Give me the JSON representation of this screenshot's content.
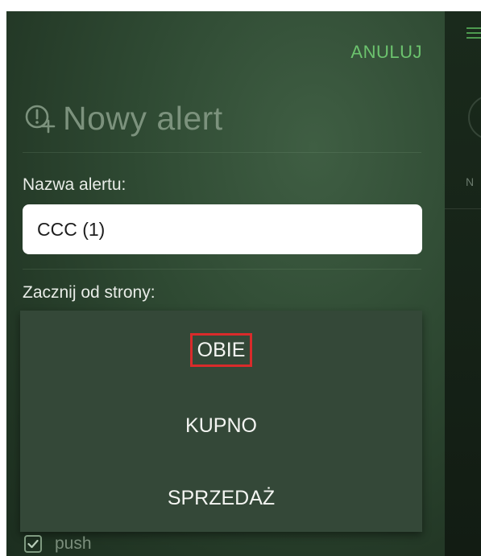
{
  "header": {
    "cancel_label": "ANULUJ",
    "title": "Nowy alert",
    "title_icon": "alert-add-icon"
  },
  "form": {
    "name_label": "Nazwa alertu:",
    "name_value": "CCC (1)",
    "side_label": "Zacznij od strony:"
  },
  "side_dropdown": {
    "options": [
      "OBIE",
      "KUPNO",
      "SPRZEDAŻ"
    ],
    "selected": "OBIE"
  },
  "notifications": {
    "push_label": "push",
    "push_checked": true
  },
  "background_view": {
    "partial_text": "N",
    "menu_icon": "menu-icon",
    "circle_icon": "circle-icon"
  },
  "colors": {
    "accent_green": "#6cc36e",
    "selection_highlight": "#d92b2b",
    "panel_green": "#2f4a33"
  }
}
